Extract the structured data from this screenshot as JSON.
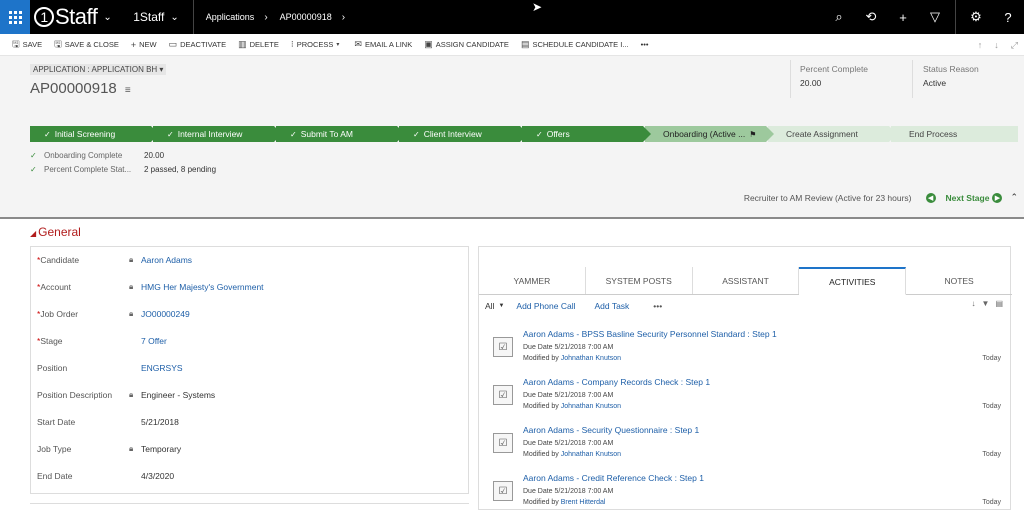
{
  "topnav": {
    "brand": "Staff",
    "brand_mark": "1",
    "app_name": "1Staff",
    "area": "Applications",
    "record": "AP00000918",
    "colors": {
      "bar": "#000000",
      "waffle": "#1e74c9"
    }
  },
  "commands": [
    {
      "label": "SAVE",
      "icon": "save-icon"
    },
    {
      "label": "SAVE & CLOSE",
      "icon": "save-close-icon"
    },
    {
      "label": "NEW",
      "icon": "plus-icon"
    },
    {
      "label": "DEACTIVATE",
      "icon": "deactivate-icon"
    },
    {
      "label": "DELETE",
      "icon": "trash-icon"
    },
    {
      "label": "PROCESS",
      "icon": "process-icon"
    },
    {
      "label": "EMAIL A LINK",
      "icon": "email-icon"
    },
    {
      "label": "ASSIGN CANDIDATE",
      "icon": "assign-icon"
    },
    {
      "label": "SCHEDULE CANDIDATE I...",
      "icon": "calendar-icon"
    },
    {
      "label": "•••",
      "icon": ""
    }
  ],
  "header": {
    "entity_selector": "APPLICATION : APPLICATION BH",
    "record_id": "AP00000918",
    "percent_complete_label": "Percent Complete",
    "percent_complete_value": "20.00",
    "status_reason_label": "Status Reason",
    "status_reason_value": "Active"
  },
  "process": {
    "stages": [
      {
        "label": "Initial Screening",
        "state": "done"
      },
      {
        "label": "Internal Interview",
        "state": "done"
      },
      {
        "label": "Submit To AM",
        "state": "done"
      },
      {
        "label": "Client Interview",
        "state": "done"
      },
      {
        "label": "Offers",
        "state": "done"
      },
      {
        "label": "Onboarding (Active ...",
        "state": "active"
      },
      {
        "label": "Create Assignment",
        "state": "todo"
      },
      {
        "label": "End Process",
        "state": "todo"
      }
    ],
    "checklist": [
      {
        "label": "Onboarding Complete",
        "value": "20.00"
      },
      {
        "label": "Percent Complete Stat...",
        "value": "2 passed, 8 pending"
      }
    ],
    "stage_info": "Recruiter to AM Review (Active for 23 hours)",
    "next_stage": "Next Stage"
  },
  "general": {
    "title": "General",
    "fields": [
      {
        "label": "Candidate",
        "required": true,
        "locked": true,
        "value": "Aaron Adams",
        "link": true
      },
      {
        "label": "Account",
        "required": true,
        "locked": true,
        "value": "HMG Her Majesty's Government",
        "link": true
      },
      {
        "label": "Job Order",
        "required": true,
        "locked": true,
        "value": "JO00000249",
        "link": true
      },
      {
        "label": "Stage",
        "required": true,
        "locked": false,
        "value": "7 Offer",
        "link": true
      },
      {
        "label": "Position",
        "required": false,
        "locked": false,
        "value": "ENGRSYS",
        "link": true
      },
      {
        "label": "Position Description",
        "required": false,
        "locked": true,
        "value": "Engineer - Systems",
        "link": false
      },
      {
        "label": "Start Date",
        "required": false,
        "locked": false,
        "value": "5/21/2018",
        "link": false
      },
      {
        "label": "Job Type",
        "required": false,
        "locked": true,
        "value": "Temporary",
        "link": false
      },
      {
        "label": "End Date",
        "required": false,
        "locked": false,
        "value": "4/3/2020",
        "link": false
      }
    ]
  },
  "social": {
    "tabs": [
      "YAMMER",
      "SYSTEM POSTS",
      "ASSISTANT",
      "ACTIVITIES",
      "NOTES"
    ],
    "active_tab": "ACTIVITIES",
    "filter": "All",
    "add_phone_call": "Add Phone Call",
    "add_task": "Add Task",
    "more": "•••",
    "activities": [
      {
        "title": "Aaron Adams - BPSS Basline Security Personnel Standard : Step 1",
        "due": "Due Date  5/21/2018 7:00 AM",
        "modified_prefix": "Modified by ",
        "modified_by": "Johnathan Knutson",
        "when": "Today"
      },
      {
        "title": "Aaron Adams - Company Records Check : Step 1",
        "due": "Due Date  5/21/2018 7:00 AM",
        "modified_prefix": "Modified by ",
        "modified_by": "Johnathan Knutson",
        "when": "Today"
      },
      {
        "title": "Aaron Adams - Security Questionnaire : Step 1",
        "due": "Due Date  5/21/2018 7:00 AM",
        "modified_prefix": "Modified by ",
        "modified_by": "Johnathan Knutson",
        "when": "Today"
      },
      {
        "title": "Aaron Adams - Credit Reference Check : Step 1",
        "due": "Due Date  5/21/2018 7:00 AM",
        "modified_prefix": "Modified by ",
        "modified_by": "Brent Hitterdal",
        "when": "Today"
      }
    ]
  }
}
